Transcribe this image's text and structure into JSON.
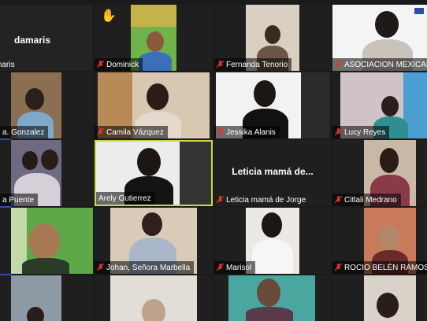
{
  "participants": [
    {
      "name": "damaris",
      "display": "damaris",
      "muted": false
    },
    {
      "name": "Dominick",
      "muted": true,
      "hand": "✋"
    },
    {
      "name": "Fernanda Tenorio",
      "muted": true
    },
    {
      "name": "ASOCIACION MEXICANA",
      "muted": true
    },
    {
      "name": "a. Gonzalez",
      "muted": false
    },
    {
      "name": "Camila Vázquez",
      "muted": true
    },
    {
      "name": "Jessika Alanis",
      "muted": true
    },
    {
      "name": "Lucy Reyes",
      "muted": true
    },
    {
      "name": "a Puente",
      "muted": false
    },
    {
      "name": "Arely Gutierrez",
      "muted": false
    },
    {
      "name": "Leticia mamá de Jorge",
      "display": "Leticia mamá de...",
      "muted": true
    },
    {
      "name": "Citlali Medrano",
      "muted": true
    },
    {
      "name": "Johan, Señora Marbella",
      "muted": true
    },
    {
      "name": "Marisol",
      "muted": true
    },
    {
      "name": "ROCIO BELÉN RAMOS R",
      "muted": true
    }
  ],
  "colors": {
    "active_border": "#c9d94a",
    "muted_icon": "#e0352b",
    "sidebar": "#2d4fa3"
  }
}
